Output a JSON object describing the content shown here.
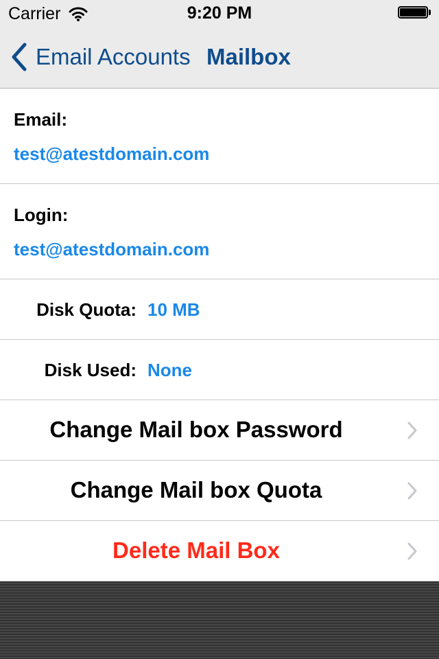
{
  "status_bar": {
    "carrier": "Carrier",
    "time": "9:20 PM",
    "icons": [
      "wifi-icon",
      "battery-icon"
    ]
  },
  "nav": {
    "back_label": "Email Accounts",
    "title": "Mailbox",
    "tint_color": "#0f4c8c"
  },
  "details": {
    "email": {
      "label": "Email:",
      "value": "test@atestdomain.com"
    },
    "login": {
      "label": "Login:",
      "value": "test@atestdomain.com"
    },
    "disk_quota": {
      "label": "Disk Quota:",
      "value": "10 MB"
    },
    "disk_used": {
      "label": "Disk Used:",
      "value": "None"
    },
    "value_color": "#1a88e8"
  },
  "actions": [
    {
      "label": "Change Mail box Password",
      "icon": "chevron-right-icon"
    },
    {
      "label": "Change Mail box Quota",
      "icon": "chevron-right-icon"
    },
    {
      "label": "Delete Mail Box",
      "icon": "chevron-right-icon",
      "color": "#ff2a1a"
    }
  ]
}
